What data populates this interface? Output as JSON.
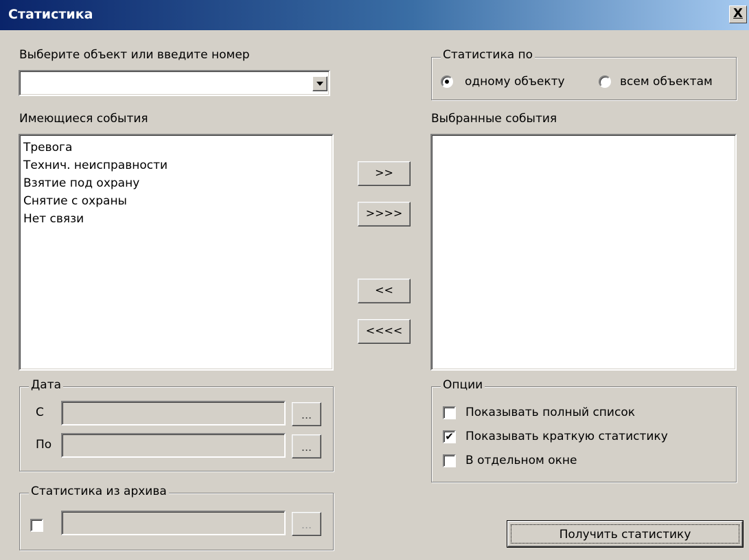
{
  "window": {
    "title": "Статистика",
    "close": "X"
  },
  "object": {
    "label": "Выберите объект или введите номер",
    "value": ""
  },
  "stat_by": {
    "title": "Статистика по",
    "options": [
      {
        "label": "одному объекту",
        "selected": true
      },
      {
        "label": "всем объектам",
        "selected": false
      }
    ]
  },
  "available": {
    "label": "Имеющиеся события",
    "items": [
      "Тревога",
      "Технич. неисправности",
      "Взятие под охрану",
      "Снятие с охраны",
      "Нет связи"
    ]
  },
  "selected_events": {
    "label": "Выбранные события",
    "items": []
  },
  "move_buttons": {
    "add": ">>",
    "add_all": ">>>>",
    "remove": "<<",
    "remove_all": "<<<<"
  },
  "date": {
    "title": "Дата",
    "from_label": "С",
    "to_label": "По",
    "browse": "...",
    "from_value": "",
    "to_value": ""
  },
  "options": {
    "title": "Опции",
    "items": [
      {
        "label": "Показывать полный список",
        "checked": false
      },
      {
        "label": "Показывать краткую статистику",
        "checked": true
      },
      {
        "label": "В отдельном окне",
        "checked": false
      }
    ]
  },
  "archive": {
    "title": "Статистика из архива",
    "checked": false,
    "browse": "...",
    "value": ""
  },
  "get_stats_button": "Получить статистику"
}
